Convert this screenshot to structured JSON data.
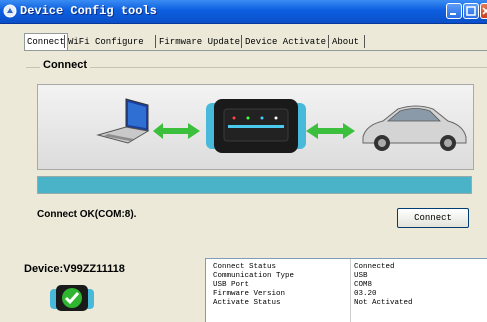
{
  "window": {
    "title": "Device Config tools"
  },
  "tabs": [
    {
      "label": "Connect"
    },
    {
      "label": "WiFi Configure"
    },
    {
      "label": "Firmware Update"
    },
    {
      "label": "Device Activate"
    },
    {
      "label": "About"
    }
  ],
  "connect": {
    "group_label": "Connect",
    "status": "Connect OK(COM:8).",
    "button_label": "Connect",
    "progress_fraction": 1.0
  },
  "device": {
    "name": "Device:V99ZZ11118"
  },
  "info": [
    {
      "key": "Connect Status",
      "value": "Connected"
    },
    {
      "key": "Communication Type",
      "value": "USB"
    },
    {
      "key": "USB Port",
      "value": "COM8"
    },
    {
      "key": "Firmware Version",
      "value": "03.20"
    },
    {
      "key": "Activate Status",
      "value": "Not Activated"
    }
  ],
  "colors": {
    "accent": "#4bb3c8",
    "arrow": "#3cbf3c",
    "title_bar": "#0d5fe0"
  },
  "icons": [
    "app-icon",
    "minimize-icon",
    "maximize-icon",
    "close-icon",
    "laptop-icon",
    "arrow-icon",
    "obd-device-icon",
    "car-icon",
    "device-status-icon",
    "checkmark-icon"
  ]
}
